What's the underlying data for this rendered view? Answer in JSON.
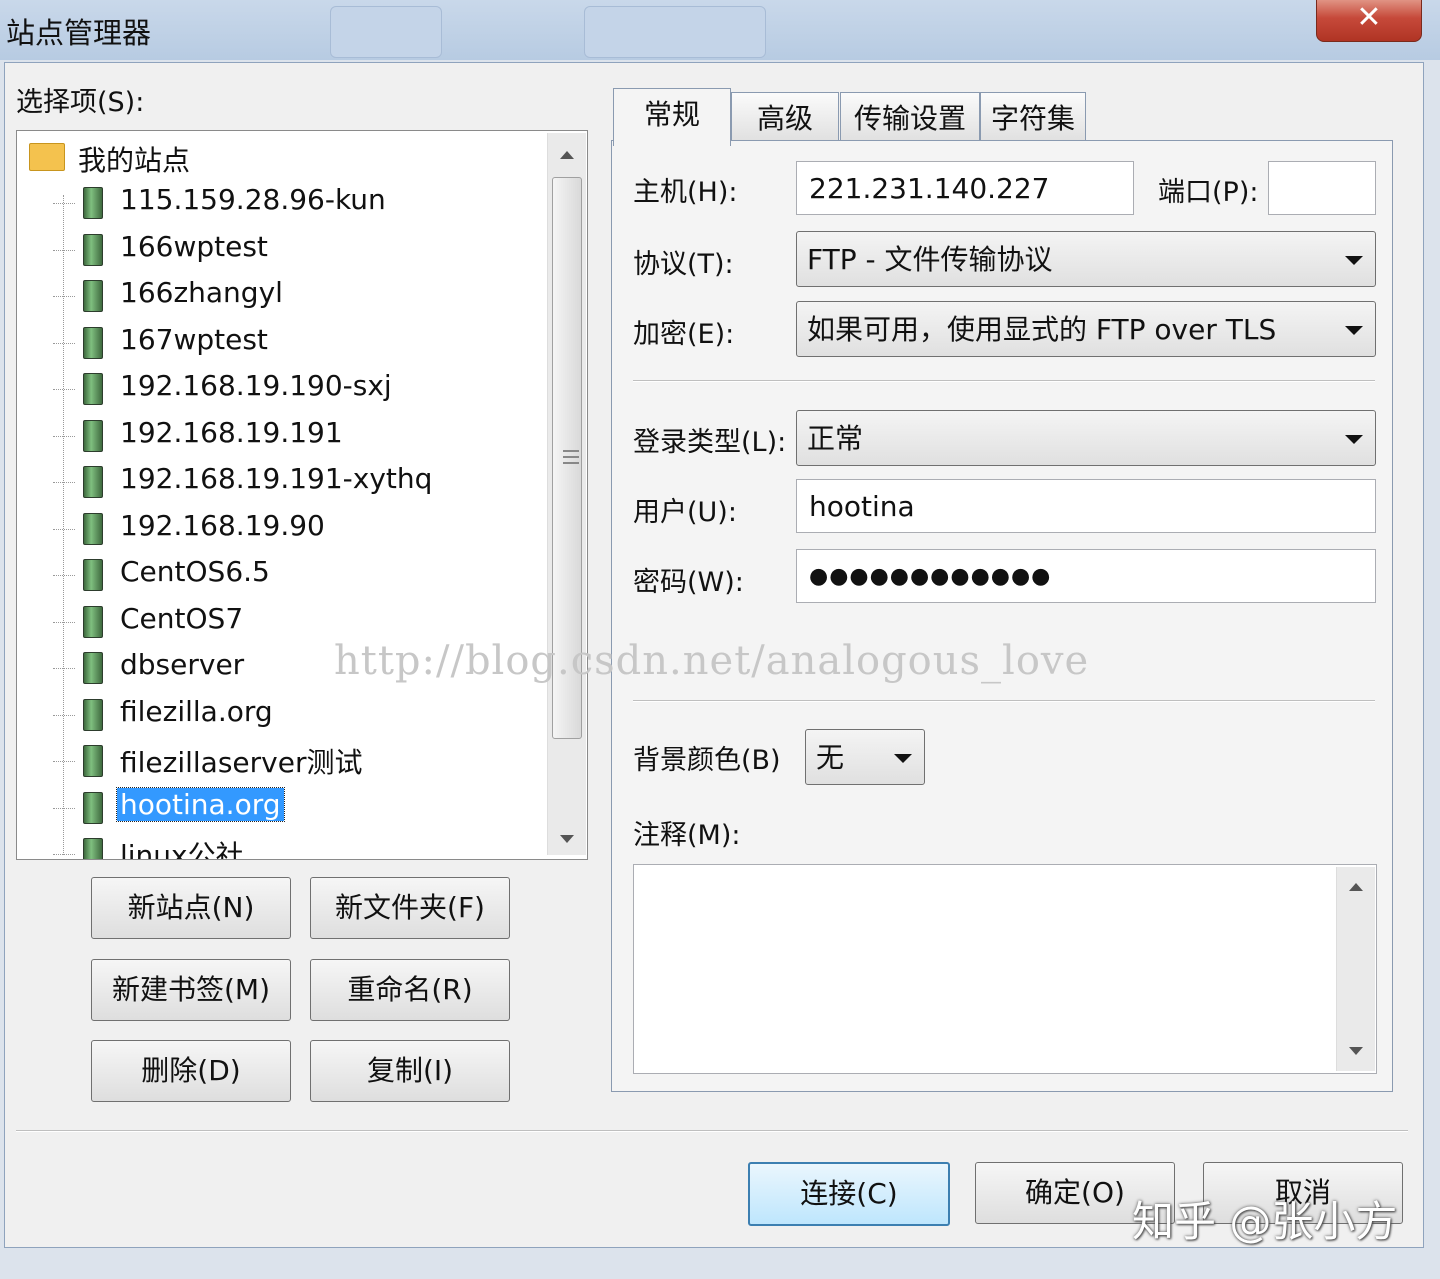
{
  "window": {
    "title": "站点管理器",
    "close_glyph": "✕"
  },
  "select_label": "选择项(S):",
  "tree": {
    "root": "我的站点",
    "items": [
      "115.159.28.96-kun",
      "166wptest",
      "166zhangyl",
      "167wptest",
      "192.168.19.190-sxj",
      "192.168.19.191",
      "192.168.19.191-xythq",
      "192.168.19.90",
      "CentOS6.5",
      "CentOS7",
      "dbserver",
      "filezilla.org",
      "filezillaserver测试",
      "hootina.org",
      "linux公社"
    ],
    "selected": "hootina.org"
  },
  "buttons": {
    "new_site": "新站点(N)",
    "new_folder": "新文件夹(F)",
    "new_bookmark": "新建书签(M)",
    "rename": "重命名(R)",
    "delete": "删除(D)",
    "copy": "复制(I)"
  },
  "tabs": [
    "常规",
    "高级",
    "传输设置",
    "字符集"
  ],
  "form": {
    "host_label": "主机(H):",
    "host_value": "221.231.140.227",
    "port_label": "端口(P):",
    "port_value": "",
    "protocol_label": "协议(T):",
    "protocol_value": "FTP - 文件传输协议",
    "encryption_label": "加密(E):",
    "encryption_value": "如果可用，使用显式的 FTP over TLS",
    "login_type_label": "登录类型(L):",
    "login_type_value": "正常",
    "user_label": "用户(U):",
    "user_value": "hootina",
    "password_label": "密码(W):",
    "password_value": "●●●●●●●●●●●●",
    "bgcolor_label": "背景颜色(B)",
    "bgcolor_value": "无",
    "comment_label": "注释(M):"
  },
  "footer": {
    "connect": "连接(C)",
    "ok": "确定(O)",
    "cancel": "取消"
  },
  "watermark": "http://blog.csdn.net/analogous_love",
  "zhihu_watermark": "知乎 @张小方",
  "icons": {
    "root": "folder-icon",
    "item": "server-icon"
  },
  "colors": {
    "selection": "#3399ff",
    "close_button": "#c6493a",
    "titlebar": "#c0d2e8"
  }
}
